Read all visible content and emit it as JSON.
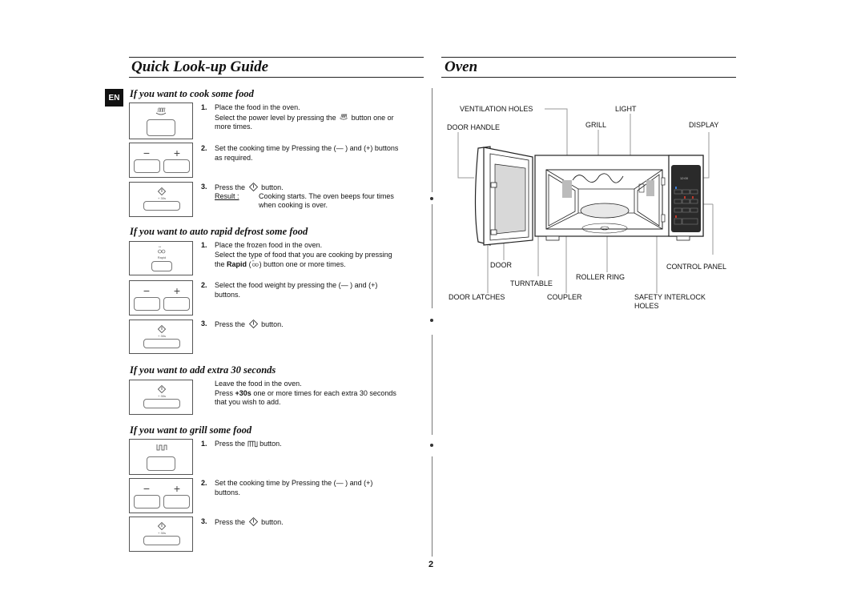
{
  "left_section": {
    "title": "Quick Look-up Guide",
    "language_badge": "EN",
    "sections": [
      {
        "title": "If you want to cook some food",
        "steps": [
          {
            "num": "1.",
            "lines": [
              "Place the food in the oven.",
              "Select the power level by pressing the",
              "button one or",
              "more times."
            ],
            "icon": "power-level-icon"
          },
          {
            "num": "2.",
            "lines": [
              "Set the cooking time by Pressing the (— ) and (+) buttons",
              "as required."
            ]
          },
          {
            "num": "3.",
            "lines": [
              "Press the",
              "button."
            ],
            "icon": "start-icon",
            "result_label": "Result :",
            "result_lines": [
              "Cooking starts. The oven beeps four times",
              "when cooking is over."
            ]
          }
        ]
      },
      {
        "title": "If you want to auto rapid defrost some food",
        "steps": [
          {
            "num": "1.",
            "lines": [
              "Place the frozen food in the oven.",
              "Select the type of food that you are cooking by pressing",
              "the",
              "Rapid",
              "(",
              ") button one or more times."
            ],
            "icon": "rapid-defrost-icon"
          },
          {
            "num": "2.",
            "lines": [
              "Select the food weight by pressing the (— ) and (+)",
              "buttons."
            ]
          },
          {
            "num": "3.",
            "lines": [
              "Press the",
              "button."
            ],
            "icon": "start-icon"
          }
        ]
      },
      {
        "title": "If you want to add extra 30 seconds",
        "steps": [
          {
            "num": "",
            "lines": [
              "Leave the food in the oven.",
              "Press",
              "+30s",
              "one or more times for each extra 30 seconds",
              "that you wish to add."
            ]
          }
        ]
      },
      {
        "title": "If you want to grill some food",
        "steps": [
          {
            "num": "1.",
            "lines": [
              "Press the",
              "button."
            ],
            "icon": "grill-icon"
          },
          {
            "num": "2.",
            "lines": [
              "Set the cooking time by Pressing the (— ) and (+)",
              "buttons."
            ]
          },
          {
            "num": "3.",
            "lines": [
              "Press the",
              "button."
            ],
            "icon": "start-icon"
          }
        ]
      }
    ],
    "button_glyphs": {
      "minus": "−",
      "plus": "+",
      "plus30": "+ 30s",
      "rapid": "Rapid"
    }
  },
  "right_section": {
    "title": "Oven",
    "labels": {
      "ventilation_holes": "VENTILATION HOLES",
      "light": "LIGHT",
      "door_handle": "DOOR HANDLE",
      "grill": "GRILL",
      "display": "DISPLAY",
      "door": "DOOR",
      "control_panel": "CONTROL PANEL",
      "roller_ring": "ROLLER RING",
      "turntable": "TURNTABLE",
      "door_latches": "DOOR LATCHES",
      "coupler": "COUPLER",
      "safety_interlock_1": "SAFETY INTERLOCK",
      "safety_interlock_2": "HOLES"
    },
    "display_readout": "12:00"
  },
  "page_number": "2"
}
